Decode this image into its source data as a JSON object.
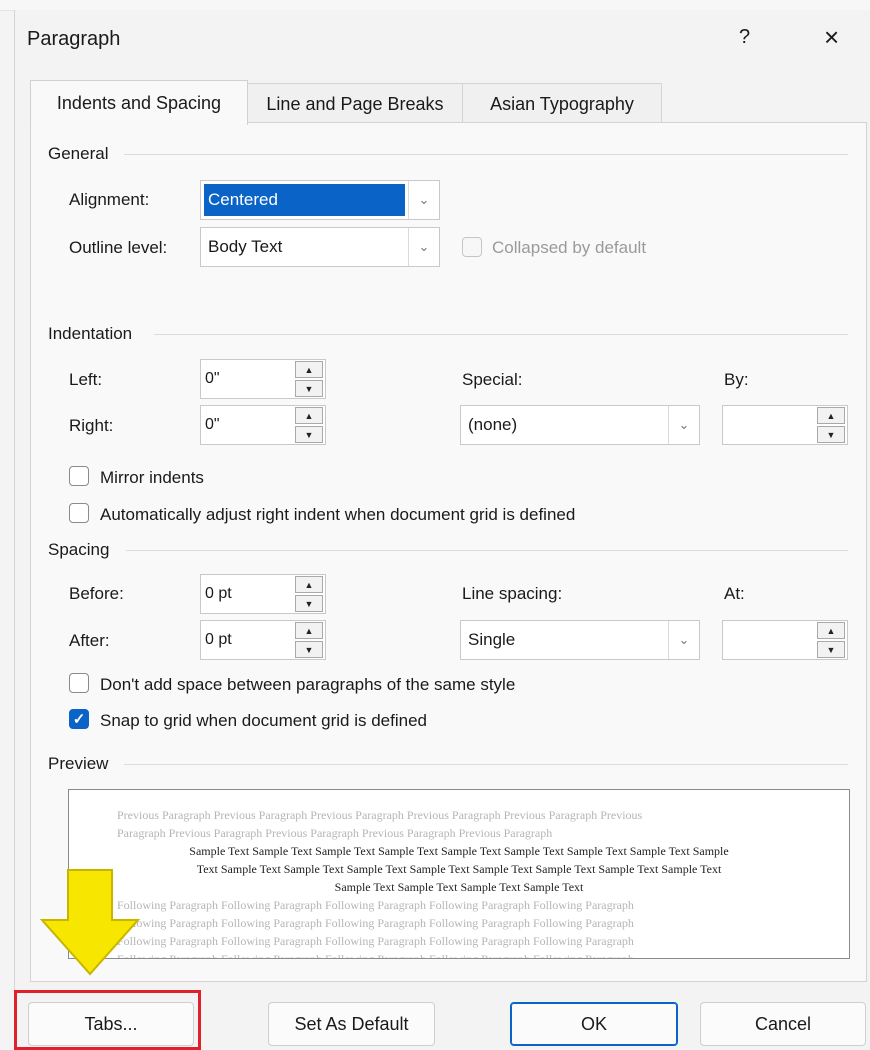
{
  "dialog": {
    "title": "Paragraph",
    "help_label": "?",
    "close_label": "×"
  },
  "tabs": [
    {
      "label": "Indents and Spacing",
      "active": true
    },
    {
      "label": "Line and Page Breaks",
      "active": false
    },
    {
      "label": "Asian Typography",
      "active": false
    }
  ],
  "general": {
    "title": "General",
    "alignment_label": "Alignment:",
    "alignment_value": "Centered",
    "outline_label": "Outline level:",
    "outline_value": "Body Text",
    "collapsed_label": "Collapsed by default"
  },
  "indentation": {
    "title": "Indentation",
    "left_label": "Left:",
    "left_value": "0\"",
    "right_label": "Right:",
    "right_value": "0\"",
    "special_label": "Special:",
    "special_value": "(none)",
    "by_label": "By:",
    "by_value": "",
    "mirror_label": "Mirror indents",
    "auto_adjust_label": "Automatically adjust right indent when document grid is defined"
  },
  "spacing": {
    "title": "Spacing",
    "before_label": "Before:",
    "before_value": "0 pt",
    "after_label": "After:",
    "after_value": "0 pt",
    "line_spacing_label": "Line spacing:",
    "line_spacing_value": "Single",
    "at_label": "At:",
    "at_value": "",
    "dont_add_label": "Don't add space between paragraphs of the same style",
    "snap_label": "Snap to grid when document grid is defined"
  },
  "preview": {
    "title": "Preview",
    "prev_line1": "Previous Paragraph Previous Paragraph Previous Paragraph Previous Paragraph Previous Paragraph Previous",
    "prev_line2": "Paragraph Previous Paragraph Previous Paragraph Previous Paragraph Previous Paragraph",
    "sample_line1": "Sample Text Sample Text Sample Text Sample Text Sample Text Sample Text Sample Text Sample Text Sample",
    "sample_line2": "Text Sample Text Sample Text Sample Text Sample Text Sample Text Sample Text Sample Text Sample Text",
    "sample_line3": "Sample Text Sample Text Sample Text Sample Text",
    "follow_line": "Following Paragraph Following Paragraph Following Paragraph Following Paragraph Following Paragraph"
  },
  "buttons": {
    "tabs": "Tabs...",
    "set_default": "Set As Default",
    "ok": "OK",
    "cancel": "Cancel"
  },
  "colors": {
    "accent": "#0a64c8",
    "highlight_arrow": "#f7e600",
    "highlight_box": "#e0202d"
  }
}
